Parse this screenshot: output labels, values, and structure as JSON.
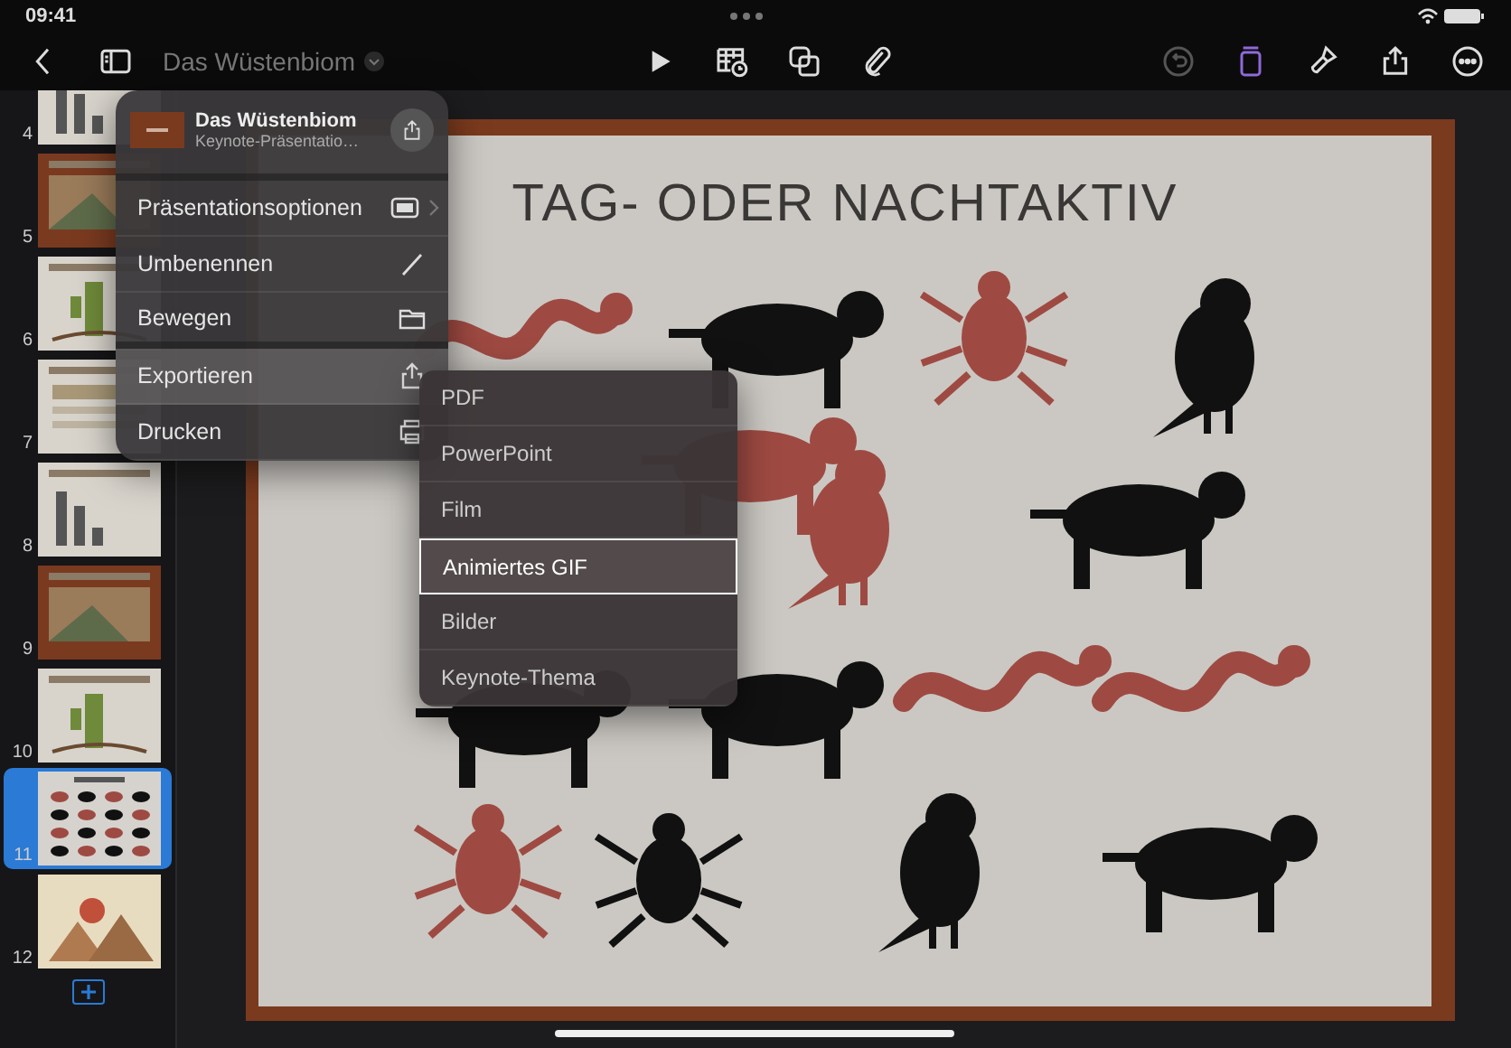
{
  "status_bar": {
    "time": "09:41"
  },
  "toolbar": {
    "title": "Das Wüstenbiom",
    "undo_disabled": true,
    "format_active": true
  },
  "slides": [
    {
      "number": "4",
      "selected": false
    },
    {
      "number": "5",
      "selected": false
    },
    {
      "number": "6",
      "selected": false
    },
    {
      "number": "7",
      "selected": false
    },
    {
      "number": "8",
      "selected": false
    },
    {
      "number": "9",
      "selected": false
    },
    {
      "number": "10",
      "selected": false
    },
    {
      "number": "11",
      "selected": true
    },
    {
      "number": "12",
      "selected": false
    }
  ],
  "slide": {
    "title": "TAG- ODER NACHTAKTIV",
    "animals": [
      {
        "kind": "reptile",
        "color": "#9e4a42"
      },
      {
        "kind": "quadruped",
        "color": "#111111"
      },
      {
        "kind": "insect",
        "color": "#9e4a42"
      },
      {
        "kind": "bird",
        "color": "#111111"
      },
      {
        "kind": "quadruped",
        "color": "#9e4a42"
      },
      {
        "kind": "bird",
        "color": "#9e4a42"
      },
      {
        "kind": "quadruped",
        "color": "#111111"
      },
      {
        "kind": "quadruped",
        "color": "#111111"
      },
      {
        "kind": "quadruped",
        "color": "#111111"
      },
      {
        "kind": "reptile",
        "color": "#9e4a42"
      },
      {
        "kind": "reptile",
        "color": "#9e4a42"
      },
      {
        "kind": "insect",
        "color": "#9e4a42"
      },
      {
        "kind": "insect",
        "color": "#111111"
      },
      {
        "kind": "bird",
        "color": "#111111"
      },
      {
        "kind": "quadruped",
        "color": "#111111"
      }
    ]
  },
  "menu": {
    "document_title": "Das Wüstenbiom",
    "document_type": "Keynote-Präsentatio…",
    "items": [
      {
        "label": "Präsentationsoptionen",
        "selected": false
      },
      {
        "label": "Umbenennen",
        "selected": false
      },
      {
        "label": "Bewegen",
        "selected": false
      },
      {
        "label": "Exportieren",
        "selected": true
      },
      {
        "label": "Drucken",
        "selected": false
      }
    ]
  },
  "export_menu": {
    "items": [
      {
        "label": "PDF",
        "selected": false
      },
      {
        "label": "PowerPoint",
        "selected": false
      },
      {
        "label": "Film",
        "selected": false
      },
      {
        "label": "Animiertes GIF",
        "selected": true
      },
      {
        "label": "Bilder",
        "selected": false
      },
      {
        "label": "Keynote-Thema",
        "selected": false
      }
    ]
  }
}
